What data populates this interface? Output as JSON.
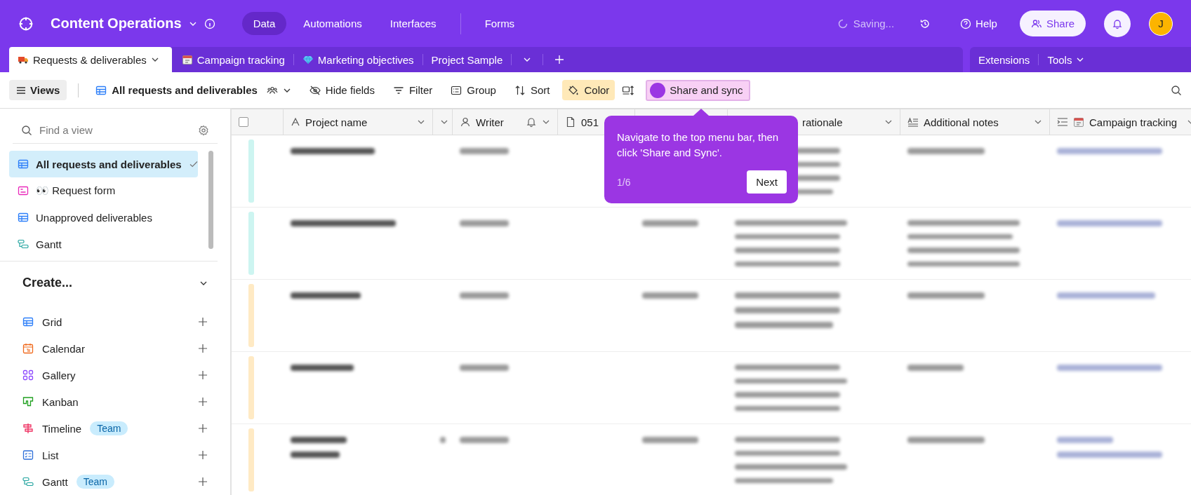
{
  "header": {
    "title": "Content Operations",
    "nav": [
      {
        "label": "Data",
        "selected": true
      },
      {
        "label": "Automations",
        "selected": false
      },
      {
        "label": "Interfaces",
        "selected": false
      },
      {
        "label": "Forms",
        "selected": false
      }
    ],
    "status": "Saving...",
    "help": "Help",
    "share": "Share",
    "avatar": "J"
  },
  "tabs": [
    {
      "label": "Requests & deliverables",
      "selected": true
    },
    {
      "label": "Campaign tracking",
      "selected": false
    },
    {
      "label": "Marketing objectives",
      "selected": false
    },
    {
      "label": "Project Sample",
      "selected": false
    }
  ],
  "tab_tools": [
    "Extensions",
    "Tools"
  ],
  "toolbar": {
    "views": "Views",
    "view_name": "All requests and deliverables",
    "actions": [
      {
        "label": "Hide fields",
        "on": false
      },
      {
        "label": "Filter",
        "on": false
      },
      {
        "label": "Group",
        "on": false
      },
      {
        "label": "Sort",
        "on": false
      },
      {
        "label": "Color",
        "on": true
      }
    ],
    "share_sync": "Share and sync"
  },
  "sidebar": {
    "search": {
      "placeholder": "Find a view"
    },
    "views": [
      {
        "label": "All requests and deliverables",
        "selected": true
      },
      {
        "label": "👀 Request form",
        "selected": false
      },
      {
        "label": "Unapproved deliverables",
        "selected": false
      },
      {
        "label": "Gantt",
        "selected": false
      }
    ],
    "create_title": "Create...",
    "create": [
      {
        "label": "Grid"
      },
      {
        "label": "Calendar"
      },
      {
        "label": "Gallery"
      },
      {
        "label": "Kanban"
      },
      {
        "label": "Timeline",
        "badge": "Team"
      },
      {
        "label": "List"
      },
      {
        "label": "Gantt",
        "badge": "Team"
      }
    ]
  },
  "table": {
    "select_all": {
      "checked": false
    },
    "columns": [
      {
        "kind": "field",
        "label": "Project name"
      },
      {
        "kind": "blank"
      },
      {
        "kind": "field",
        "label": "Writer"
      },
      {
        "kind": "field",
        "label": "051"
      },
      {
        "kind": "blank"
      },
      {
        "kind": "field",
        "label": "rationale"
      },
      {
        "kind": "field",
        "label": "Additional notes"
      },
      {
        "kind": "field",
        "label": "Campaign tracking"
      }
    ],
    "rows": [
      {
        "color": "#cdf5f1"
      },
      {
        "color": "#cdf5f1"
      },
      {
        "color": "#ffeac4"
      },
      {
        "color": "#ffeac4"
      },
      {
        "color": "#ffeac4"
      }
    ]
  },
  "tour": {
    "text": "Navigate to the top menu bar, then click 'Share and Sync'.",
    "step": "1/6",
    "next": "Next"
  }
}
